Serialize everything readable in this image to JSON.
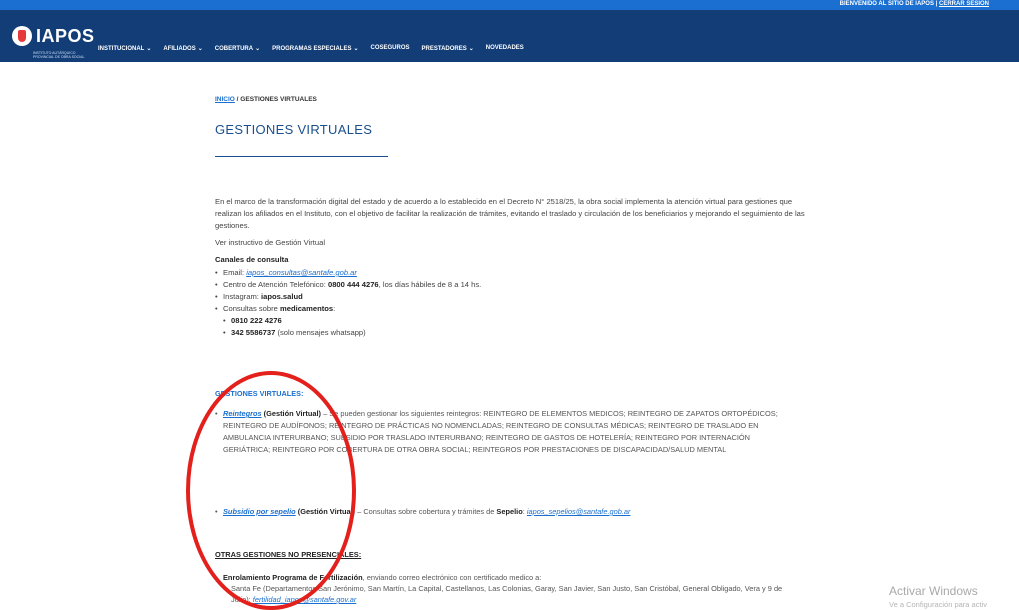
{
  "topbar": {
    "welcome": "BIENVENIDO AL SITIO DE IAPOS |",
    "logout": "CERRAR SESIÓN"
  },
  "logo": {
    "text": "IAPOS",
    "subtitle": "INSTITUTO AUTÁRQUICO PROVINCIAL DE OBRA SOCIAL"
  },
  "nav": {
    "items": [
      {
        "label": "INSTITUCIONAL",
        "has_dropdown": true
      },
      {
        "label": "AFILIADOS",
        "has_dropdown": true
      },
      {
        "label": "COBERTURA",
        "has_dropdown": true
      },
      {
        "label": "PROGRAMAS ESPECIALES",
        "has_dropdown": true
      },
      {
        "label": "COSEGUROS",
        "has_dropdown": false
      },
      {
        "label": "PRESTADORES",
        "has_dropdown": true
      },
      {
        "label": "NOVEDADES",
        "has_dropdown": false
      }
    ]
  },
  "breadcrumb": {
    "home": "INICIO",
    "sep": " / ",
    "current": "GESTIONES VIRTUALES"
  },
  "page": {
    "title": "GESTIONES VIRTUALES"
  },
  "content": {
    "intro": "En el marco de la transformación digital del estado y de acuerdo a lo establecido en el Decreto N° 2518/25, la obra social implementa la atención virtual para gestiones que realizan los afiliados en el Instituto, con el objetivo de facilitar la realización de trámites, evitando el traslado y circulación de los beneficiarios y mejorando el seguimiento de las gestiones.",
    "instructivo": "Ver instructivo de Gestión Virtual",
    "canales_title": "Canales de consulta",
    "email_label": "Email: ",
    "email": "iapos_consultas@santafe.gob.ar",
    "tel_label": "Centro de Atención Telefónico: ",
    "tel": "0800 444 4276",
    "tel_suffix": ", los días hábiles de 8 a 14 hs.",
    "ig_label": "Instagram: ",
    "ig": "iapos.salud",
    "med_label": "Consultas sobre ",
    "med_bold": "medicamentos",
    "med_suffix": ":",
    "phone1": "0810 222 4276",
    "phone2": "342 5586737",
    "phone2_suffix": " (solo mensajes whatsapp)"
  },
  "gestiones": {
    "title": "GESTIONES VIRTUALES:",
    "reintegros_link": "Reintegros",
    "reintegros_tag": " (Gestión Virtual) ",
    "reintegros_text": "– Se pueden gestionar los siguientes reintegros: REINTEGRO DE ELEMENTOS MEDICOS; REINTEGRO DE ZAPATOS ORTOPÉDICOS; REINTEGRO DE AUDÍFONOS; REINTEGRO DE PRÁCTICAS NO NOMENCLADAS; REINTEGRO DE CONSULTAS MÉDICAS; REINTEGRO DE TRASLADO EN AMBULANCIA INTERURBANO; SUBSIDIO POR TRASLADO INTERURBANO; REINTEGRO DE GASTOS DE HOTELERÍA; REINTEGRO POR INTERNACIÓN GERIÁTRICA; REINTEGRO POR COBERTURA DE OTRA OBRA SOCIAL; REINTEGROS POR PRESTACIONES DE DISCAPACIDAD/SALUD MENTAL",
    "sepelio_link": "Subsidio por sepelio",
    "sepelio_tag": " (Gestión Virtual) ",
    "sepelio_text": "– Consultas sobre cobertura y trámites de ",
    "sepelio_bold": "Sepelio",
    "sepelio_colon": ": ",
    "sepelio_email": "iapos_sepelios@santafe.gob.ar"
  },
  "otras": {
    "title": "OTRAS GESTIONES NO PRESENCIALES:",
    "enrol_bold": "Enrolamiento Programa de Fertilización",
    "enrol_text": ", enviando correo electrónico con certificado medico a:",
    "santafe_text": "Santa Fe (Departamentos San Jerónimo, San Martín, La Capital, Castellanos, Las Colonias, Garay, San Javier, San Justo, San Cristóbal, General Obligado, Vera y 9 de Julio): ",
    "santafe_email": "fertilidad_iapos@santafe.gov.ar"
  },
  "watermark": {
    "title": "Activar Windows",
    "subtitle": "Ve a Configuración para activ"
  },
  "colors": {
    "topbar": "#1a6fd0",
    "navbar": "#123d76",
    "title": "#1a4f8f",
    "link": "#1a6fd0",
    "annotation_circle": "#e3201b"
  }
}
